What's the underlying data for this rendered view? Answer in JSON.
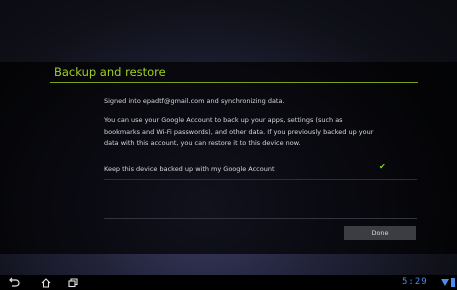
{
  "screen": {
    "title": "Backup and restore",
    "signed_in": "Signed into epadtf@gmail.com and synchronizing data.",
    "description": "You can use your Google Account to back up your apps, settings (such as bookmarks and Wi-Fi passwords), and other data. If you previously backed up your data with this account, you can restore it to this device now.",
    "option_label": "Keep this device backed up with my Google Account",
    "option_checked": true,
    "check_glyph": "✔",
    "done_label": "Done"
  },
  "system_bar": {
    "clock": "5:29",
    "icons": [
      "back-icon",
      "home-icon",
      "recent-apps-icon",
      "wifi-icon",
      "battery-icon"
    ]
  },
  "colors": {
    "accent": "#9fd020",
    "clock": "#4a8eea"
  }
}
